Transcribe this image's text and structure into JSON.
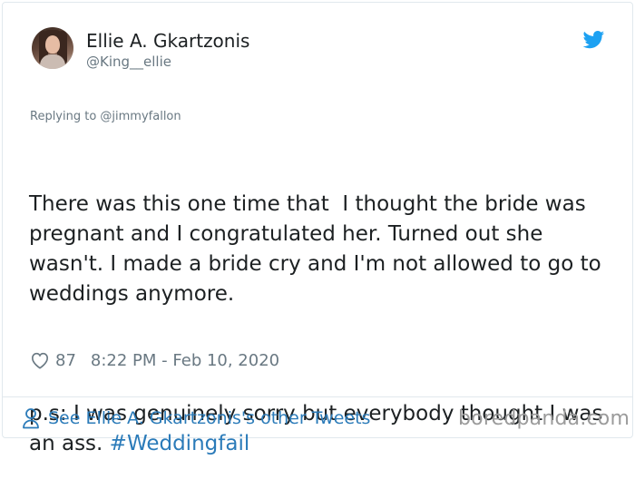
{
  "author": {
    "name": "Ellie A. Gkartzonis",
    "handle": "@King__ellie",
    "avatar_icon": "profile-photo"
  },
  "brand": {
    "icon": "twitter-bird-icon",
    "color": "#1da1f2"
  },
  "tweet": {
    "replying_to": "Replying to @jimmyfallon",
    "paragraph1": "There was this one time that  I thought the bride was pregnant and I congratulated her. Turned out she wasn't. I made a bride cry and I'm not allowed to go to weddings anymore.",
    "paragraph2_text": "p.s: I was genuinely sorry but everybody thought I was an ass. ",
    "hashtag": "#Weddingfail",
    "likes": "87",
    "timestamp": "8:22 PM - Feb 10, 2020"
  },
  "footer": {
    "other_tweets_link": "See Ellie A. Gkartzonis's other Tweets",
    "watermark": "boredpanda.com"
  },
  "colors": {
    "link": "#2b7bb9",
    "muted": "#697882",
    "text": "#1c2022",
    "border": "#e1e8ed"
  }
}
